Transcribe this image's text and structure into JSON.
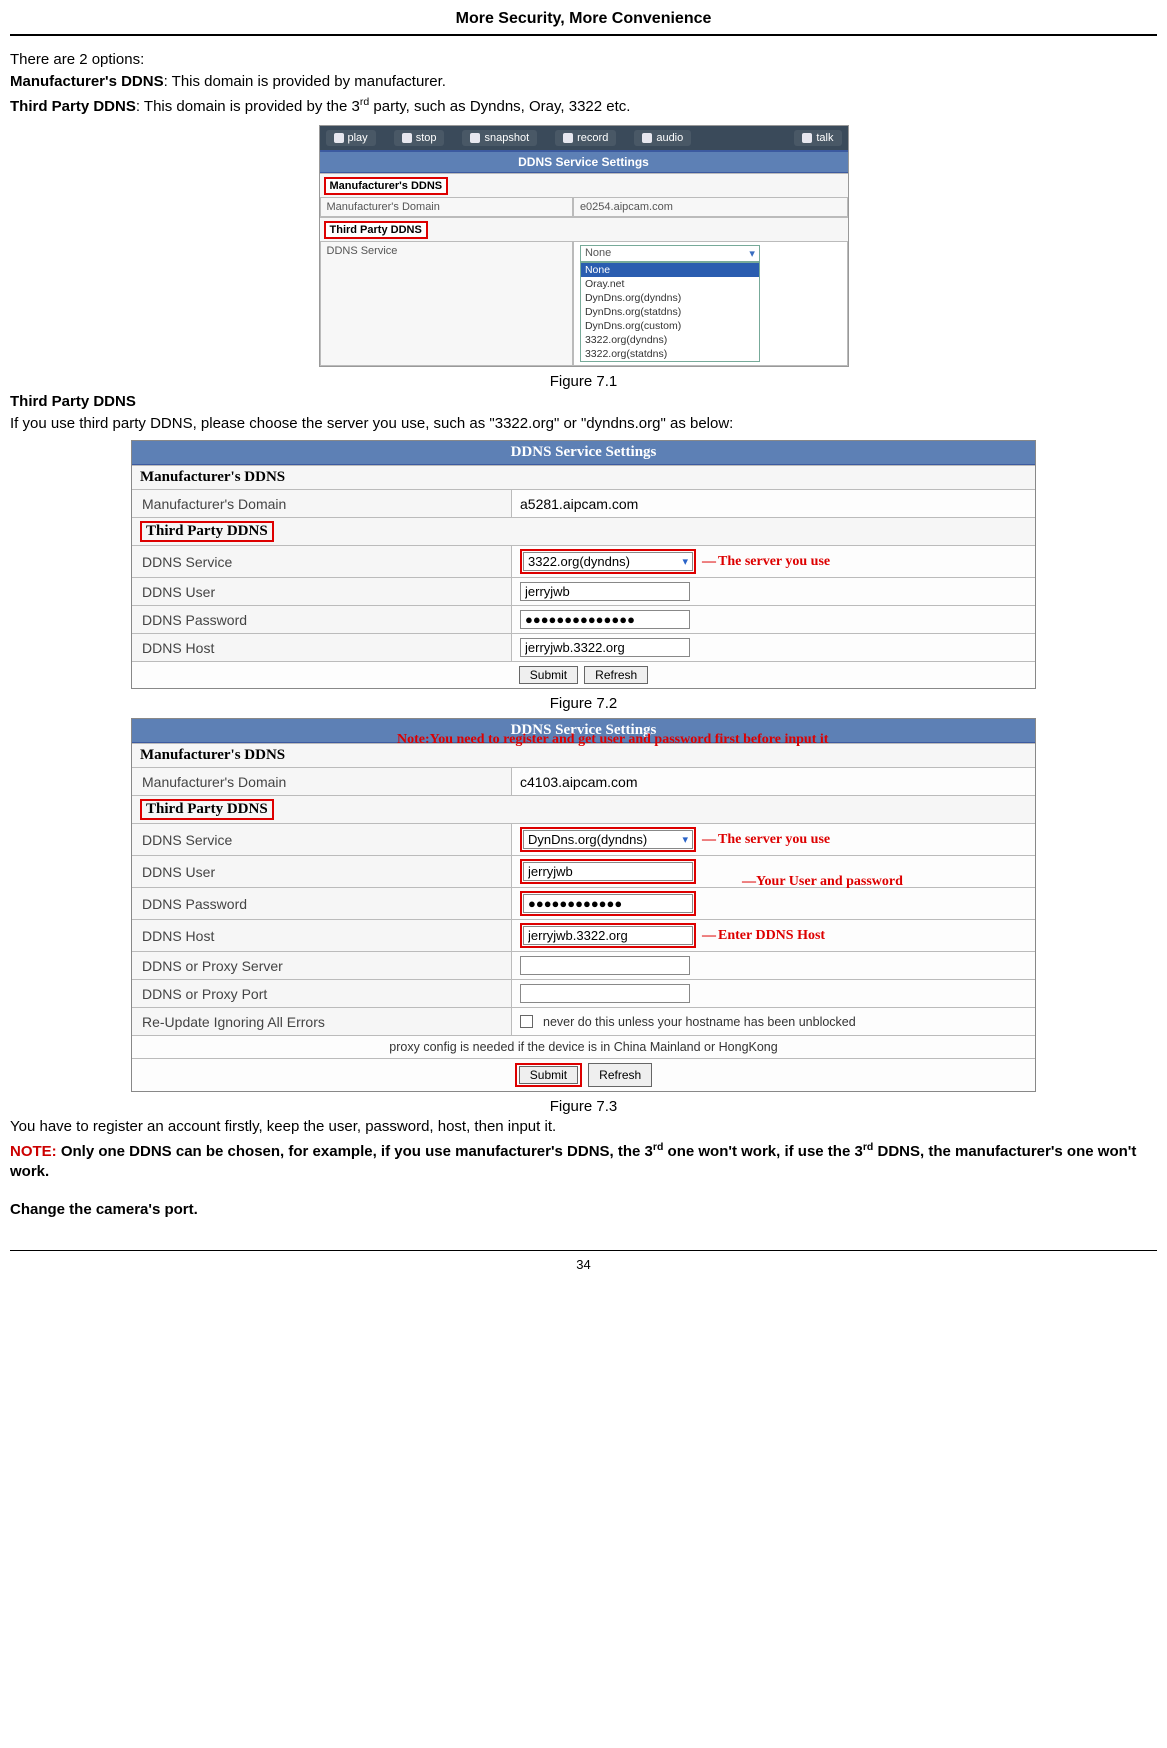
{
  "header": {
    "title": "More Security, More Convenience"
  },
  "intro": {
    "p1": "There are 2 options:",
    "opt1_label": "Manufacturer's DDNS",
    "opt1_text": ": This domain is provided by manufacturer.",
    "opt2_label": "Third Party DDNS",
    "opt2_text": ": This domain is provided by the 3",
    "opt2_sup": "rd",
    "opt2_text2": " party, such as Dyndns, Oray, 3322 etc."
  },
  "fig71": {
    "toolbar": {
      "play": "play",
      "stop": "stop",
      "snapshot": "snapshot",
      "record": "record",
      "audio": "audio",
      "talk": "talk"
    },
    "panel_title": "DDNS Service Settings",
    "manuf_label": "Manufacturer's DDNS",
    "manuf_domain_label": "Manufacturer's Domain",
    "manuf_domain_value": "e0254.aipcam.com",
    "third_label": "Third Party DDNS",
    "service_label": "DDNS Service",
    "service_sel": "None",
    "options": [
      "None",
      "Oray.net",
      "DynDns.org(dyndns)",
      "DynDns.org(statdns)",
      "DynDns.org(custom)",
      "3322.org(dyndns)",
      "3322.org(statdns)"
    ],
    "caption": "Figure 7.1"
  },
  "section2": {
    "heading": "Third Party DDNS",
    "text": "If you use third party DDNS, please choose the server you use, such as \"3322.org\" or \"dyndns.org\" as below:"
  },
  "fig72": {
    "panel_title": "DDNS Service Settings",
    "manuf_section": "Manufacturer's DDNS",
    "manuf_domain_label": "Manufacturer's Domain",
    "manuf_domain_value": "a5281.aipcam.com",
    "third_section": "Third Party DDNS",
    "service_label": "DDNS Service",
    "service_value": "3322.org(dyndns)",
    "user_label": "DDNS User",
    "user_value": "jerryjwb",
    "pass_label": "DDNS Password",
    "pass_value": "●●●●●●●●●●●●●●",
    "host_label": "DDNS Host",
    "host_value": "jerryjwb.3322.org",
    "annot_server": "The server you use",
    "submit": "Submit",
    "refresh": "Refresh",
    "caption": "Figure 7.2"
  },
  "fig73": {
    "panel_title": "DDNS Service Settings",
    "manuf_section": "Manufacturer's DDNS",
    "note_top": "Note:You need to register and get user and password first before input it",
    "manuf_domain_label": "Manufacturer's Domain",
    "manuf_domain_value": "c4103.aipcam.com",
    "third_section": "Third Party DDNS",
    "service_label": "DDNS Service",
    "service_value": "DynDns.org(dyndns)",
    "annot_server": "The server you use",
    "user_label": "DDNS User",
    "user_value": "jerryjwb",
    "annot_userpass": "Your User and password",
    "pass_label": "DDNS Password",
    "pass_value": "●●●●●●●●●●●●",
    "host_label": "DDNS Host",
    "host_value": "jerryjwb.3322.org",
    "annot_host": "Enter DDNS Host",
    "proxysrv_label": "DDNS or Proxy Server",
    "proxyport_label": "DDNS or Proxy Port",
    "reupdate_label": "Re-Update Ignoring All Errors",
    "reupdate_text": "never do this unless your hostname has been unblocked",
    "proxy_note": "proxy config is needed if the device is in China Mainland or HongKong",
    "submit": "Submit",
    "refresh": "Refresh",
    "caption": "Figure 7.3"
  },
  "outro": {
    "p1": "You have to register an account firstly, keep the user, password, host, then input it.",
    "note_label": "NOTE:",
    "note_text1": " Only one DDNS can be chosen, for example, if you use manufacturer's DDNS, the 3",
    "note_sup1": "rd",
    "note_text2": " one won't work, if use the 3",
    "note_sup2": "rd",
    "note_text3": " DDNS, the manufacturer's one won't work.",
    "p2": "Change the camera's port."
  },
  "page_number": "34"
}
